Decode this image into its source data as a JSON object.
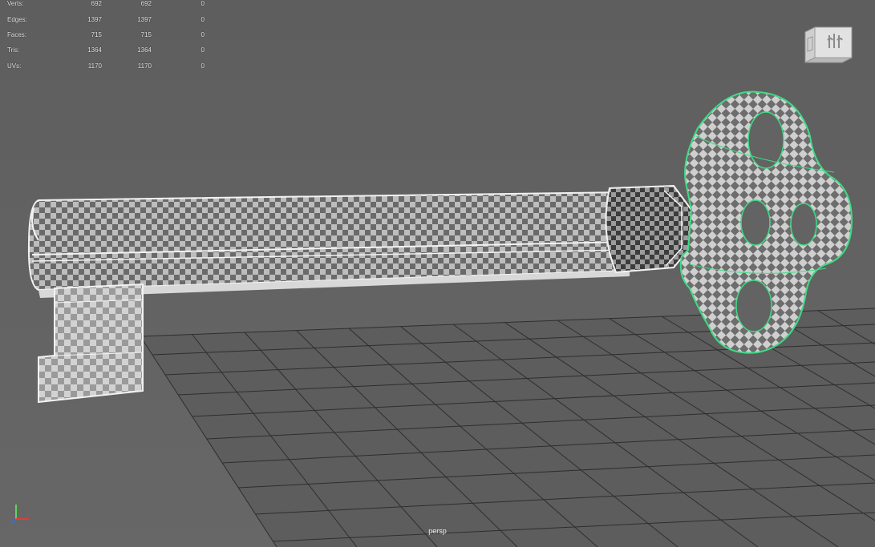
{
  "poly_count": {
    "rows": [
      {
        "label": "Verts:",
        "values": [
          "692",
          "692",
          "0"
        ]
      },
      {
        "label": "Edges:",
        "values": [
          "1397",
          "1397",
          "0"
        ]
      },
      {
        "label": "Faces:",
        "values": [
          "715",
          "715",
          "0"
        ]
      },
      {
        "label": "Tris:",
        "values": [
          "1364",
          "1364",
          "0"
        ]
      },
      {
        "label": "UVs:",
        "values": [
          "1170",
          "1170",
          "0"
        ]
      }
    ]
  },
  "view_cube": {
    "icon": "view-cube-icon"
  },
  "axis_gizmo": {
    "icon": "axis-gizmo-icon",
    "colors": {
      "x": "#e23b3b",
      "y": "#5fd35f",
      "z": "#3b6be2"
    }
  },
  "camera": {
    "label": "persp"
  },
  "colors": {
    "background": "#636363",
    "grid": "#2e2e2e",
    "wireframe": "#eeeeee",
    "selection": "#3ddc84"
  }
}
